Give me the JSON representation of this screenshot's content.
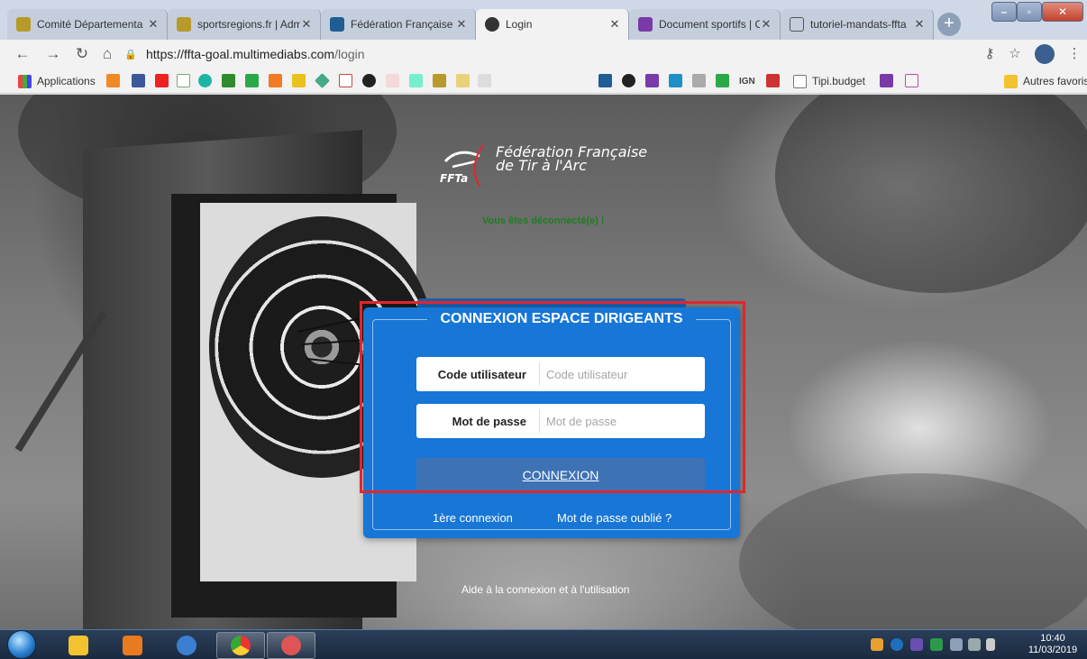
{
  "browser": {
    "tabs": [
      {
        "title": "Comité Départementa",
        "active": false,
        "favicon_color": "#b89a2a"
      },
      {
        "title": "sportsregions.fr | Adm",
        "active": false,
        "favicon_color": "#b89a2a"
      },
      {
        "title": "Fédération Française",
        "active": false,
        "favicon_color": "#1f5d94"
      },
      {
        "title": "Login",
        "active": true,
        "favicon_color": "#333333"
      },
      {
        "title": "Document sportifs | C",
        "active": false,
        "favicon_color": "#7a3aa8"
      },
      {
        "title": "tutoriel-mandats-ffta",
        "active": false,
        "favicon_color": "#555555"
      }
    ],
    "url_host": "https://ffta-goal.multimediabs.com",
    "url_path": "/login",
    "bookmarks": {
      "apps_label": "Applications",
      "ign_label": "IGN",
      "tipi_label": "Tipi.budget",
      "other_label": "Autres favoris"
    }
  },
  "page": {
    "brand": {
      "name_line1": "Fédération Française",
      "name_line2": "de Tir à l'Arc",
      "logo_text": "FFTa"
    },
    "logout_message": "Vous êtes déconnecté(e) !",
    "login": {
      "title": "CONNEXION ESPACE DIRIGEANTS",
      "username_label": "Code utilisateur",
      "username_placeholder": "Code utilisateur",
      "password_label": "Mot de passe",
      "password_placeholder": "Mot de passe",
      "submit_label": "CONNEXION",
      "first_login_link": "1ère connexion",
      "forgot_password_link": "Mot de passe oublié ?"
    },
    "help_link": "Aide à la connexion et à l'utilisation"
  },
  "taskbar": {
    "time": "10:40",
    "date": "11/03/2019"
  },
  "colors": {
    "panel_blue": "#1776d6",
    "button_blue": "#3d72b5",
    "highlight_red": "#e0262d",
    "logout_green": "#1f7d1f"
  }
}
